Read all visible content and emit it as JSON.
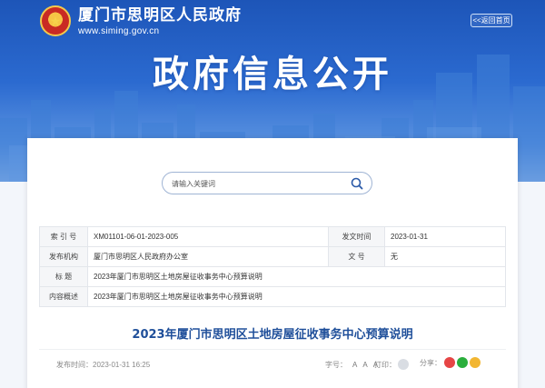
{
  "header": {
    "site_name": "厦门市思明区人民政府",
    "site_url": "www.siming.gov.cn",
    "back_label": "<<返回首页",
    "page_heading": "政府信息公开"
  },
  "search": {
    "placeholder": "请输入关键词"
  },
  "meta": {
    "index_label": "索 引 号",
    "index_value": "XM01101-06-01-2023-005",
    "date_label": "发文时间",
    "date_value": "2023-01-31",
    "issuer_label": "发布机构",
    "issuer_value": "厦门市思明区人民政府办公室",
    "docno_label": "文 号",
    "docno_value": "无",
    "title_label": "标 题",
    "title_value": "2023年厦门市思明区土地房屋征收事务中心预算说明",
    "summary_label": "内容概述",
    "summary_value": "2023年厦门市思明区土地房屋征收事务中心预算说明"
  },
  "article": {
    "title": "2023年厦门市思明区土地房屋征收事务中心预算说明",
    "publish_label": "发布时间：",
    "publish_value": "2023-01-31 16:25",
    "font_size_label": "字号：",
    "font_sizes": [
      "A",
      "A",
      "A"
    ],
    "print_label": "打印：",
    "share_label": "分享："
  },
  "icons": {
    "search": "search-icon",
    "print": "print-icon",
    "share": [
      "weibo-icon",
      "wechat-icon",
      "moments-icon"
    ]
  },
  "colors": {
    "banner": "#2b6ad0",
    "title": "#1f4f9a"
  }
}
